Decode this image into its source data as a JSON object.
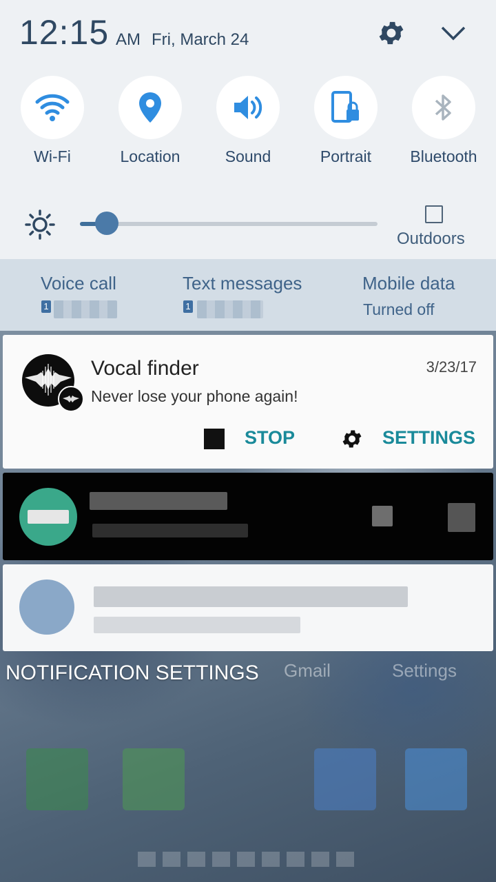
{
  "status": {
    "time": "12:15",
    "ampm": "AM",
    "date": "Fri, March 24"
  },
  "quick_tiles": [
    {
      "label": "Wi-Fi",
      "icon": "wifi-icon",
      "active": true
    },
    {
      "label": "Location",
      "icon": "location-pin-icon",
      "active": true
    },
    {
      "label": "Sound",
      "icon": "speaker-icon",
      "active": true
    },
    {
      "label": "Portrait",
      "icon": "portrait-lock-icon",
      "active": true
    },
    {
      "label": "Bluetooth",
      "icon": "bluetooth-icon",
      "active": false
    }
  ],
  "brightness": {
    "level": 0.09,
    "outdoors_label": "Outdoors",
    "outdoors_checked": false
  },
  "carrier": {
    "voice": {
      "title": "Voice call",
      "sim": "1"
    },
    "text": {
      "title": "Text messages",
      "sim": "1"
    },
    "data": {
      "title": "Mobile data",
      "status": "Turned off"
    }
  },
  "notification": {
    "app": "Vocal finder",
    "date": "3/23/17",
    "text": "Never lose your phone again!",
    "stop_label": "STOP",
    "settings_label": "SETTINGS"
  },
  "footer": {
    "notification_settings": "NOTIFICATION SETTINGS"
  },
  "background_labels": {
    "gmail": "Gmail",
    "settings": "Settings"
  },
  "colors": {
    "accent_blue": "#2f8de0",
    "action_teal": "#1a8a9a",
    "panel_bg": "#eef1f4",
    "carrier_bg": "#d3dde6"
  }
}
